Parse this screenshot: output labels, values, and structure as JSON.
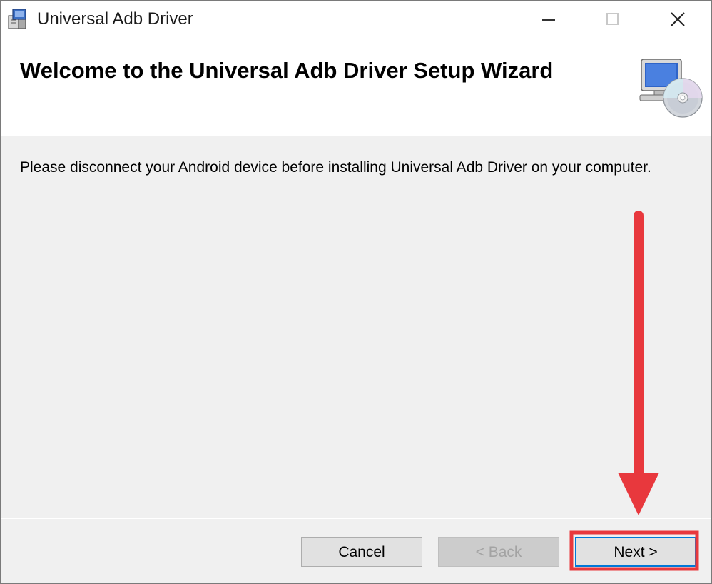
{
  "window": {
    "title": "Universal Adb Driver"
  },
  "banner": {
    "heading": "Welcome to the Universal Adb Driver Setup Wizard",
    "image_icon": "computer-cd-icon"
  },
  "body": {
    "message": "Please disconnect your Android device before installing Universal Adb Driver on your computer."
  },
  "buttons": {
    "cancel_label": "Cancel",
    "back_label": "< Back",
    "next_label": "Next >"
  },
  "annotation": {
    "color": "#e8383d",
    "icon": "red-arrow-down"
  },
  "colors": {
    "window_bg": "#f0f0f0",
    "banner_bg": "#ffffff",
    "focus_border": "#0078d7"
  }
}
